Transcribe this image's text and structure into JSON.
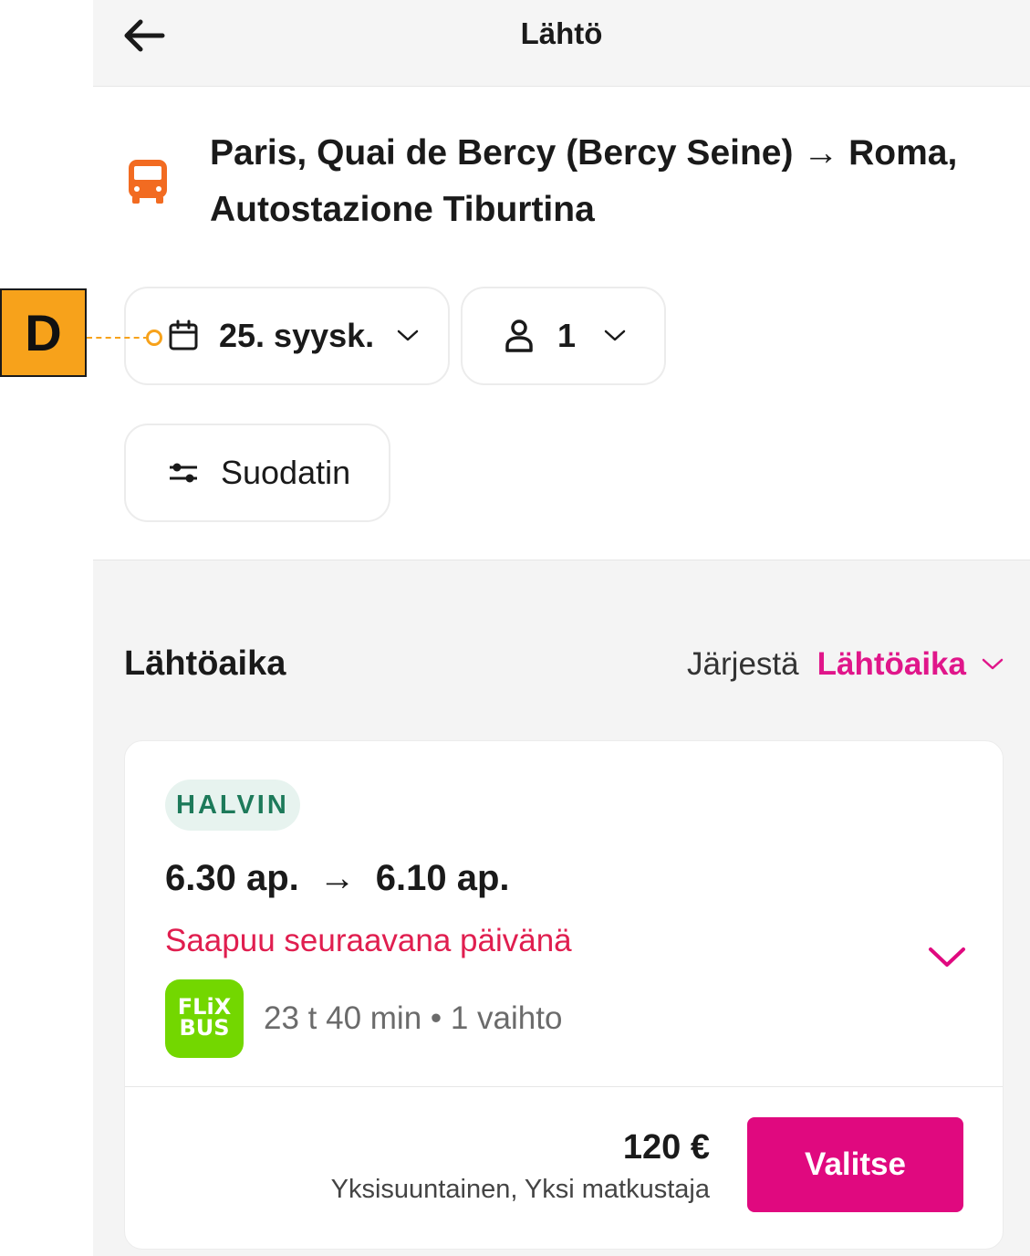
{
  "header": {
    "title": "Lähtö",
    "back_icon": "arrow-left-icon"
  },
  "route": {
    "icon": "bus-icon",
    "title": "Paris, Quai de Bercy (Bercy Seine) → Roma, Autostazione Tiburtina"
  },
  "search": {
    "date": "25. syysk.",
    "passengers": "1",
    "filter_label": "Suodatin"
  },
  "results": {
    "section_title": "Lähtöaika",
    "sort_label": "Järjestä",
    "sort_value": "Lähtöaika"
  },
  "connection": {
    "badge": "HALVIN",
    "departure": "6.30 ap.",
    "arrow": "→",
    "arrival": "6.10 ap.",
    "arrival_note": "Saapuu seuraavana päivänä",
    "operator_logo_line1": "FLiX",
    "operator_logo_line2": "BUS",
    "duration": "23 t 40 min • 1 vaihto",
    "price": "120 €",
    "price_note": "Yksisuuntainen, Yksi matkustaja",
    "select_label": "Valitse"
  },
  "annotation": {
    "label": "D"
  },
  "colors": {
    "accent": "#e0097f",
    "bus_icon": "#f26b21",
    "warning": "#e01e4f",
    "badge_bg": "#e7f3ef",
    "badge_text": "#1d7a5a",
    "flixbus": "#73d700",
    "callout": "#f7a21b"
  }
}
